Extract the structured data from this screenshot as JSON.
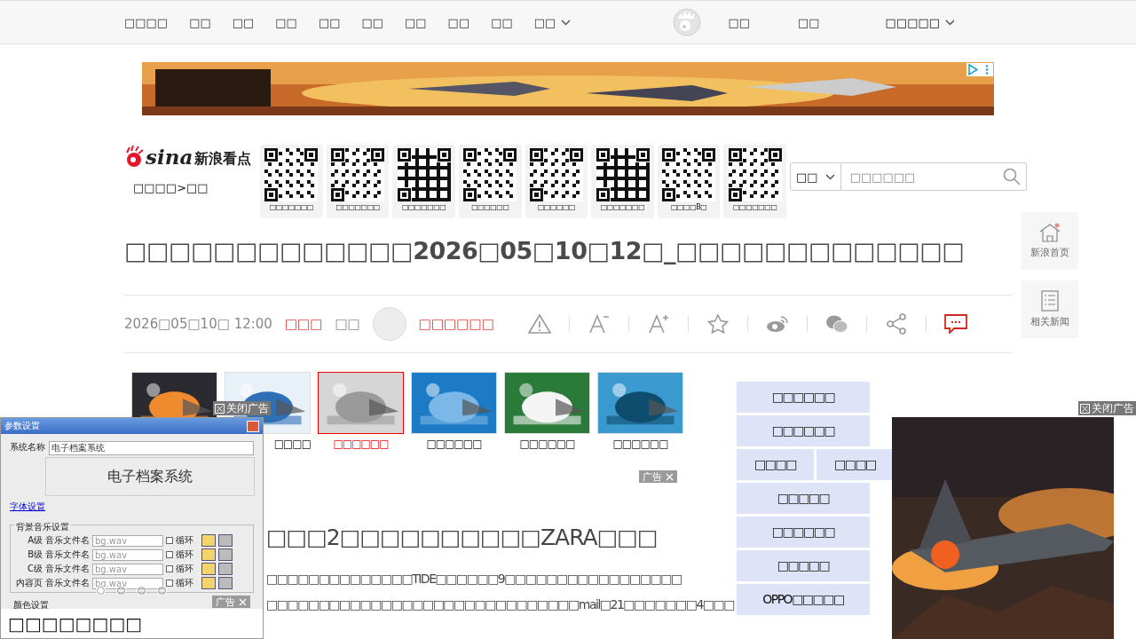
{
  "nav": {
    "items": [
      "□□□□",
      "□□",
      "□□",
      "□□",
      "□□",
      "□□",
      "□□",
      "□□",
      "□□"
    ],
    "more": "□□",
    "user_links": [
      "□□",
      "□□"
    ],
    "region": "□□□□□"
  },
  "header": {
    "logo_latin": "sina",
    "logo_cn": "新浪看点",
    "breadcrumb": "□□□□>□□",
    "qr_codes": [
      {
        "caption": "□□□□□□□"
      },
      {
        "caption": "□□□□□□□"
      },
      {
        "caption": "□□□□□□□"
      },
      {
        "caption": "□□□□□□"
      },
      {
        "caption": "□□□□□□"
      },
      {
        "caption": "□□□□□□□"
      },
      {
        "caption": "□□□□B□"
      },
      {
        "caption": "□□□□□□□"
      }
    ],
    "search": {
      "scope": "□□",
      "placeholder": "□□□□□□"
    }
  },
  "side_buttons": [
    {
      "kind": "home",
      "label": "新浪首页"
    },
    {
      "kind": "list",
      "label": "相关新闻"
    }
  ],
  "article": {
    "title": "□□□□□□□□□□□□□2026□05□10□12□_□□□□□□□□□□□□□",
    "date": "2026□05□10□ 12:00",
    "source": "□□□",
    "via": "□□",
    "author": "□□□□□□",
    "actions": [
      {
        "kind": "report"
      },
      {
        "kind": "smaller"
      },
      {
        "kind": "larger"
      },
      {
        "kind": "star"
      },
      {
        "kind": "weibo"
      },
      {
        "kind": "wechat"
      },
      {
        "kind": "share"
      },
      {
        "kind": "comment"
      }
    ],
    "subtitle": "□□□2□□□□□□□□□□ZARA□□□",
    "paragraph_lines": [
      "□□□□□□□□□□□□□□TIDE□□□□□□9□□□□□□□□□□□□□□□□□",
      "□□□□□□□□□□□□□□□□□□□□□□□□□□□□□□mail□21□□□□□□□4□□□"
    ]
  },
  "related": [
    {
      "selected": false
    },
    {
      "caption": "□□□□",
      "selected": false
    },
    {
      "caption": "□□□□□□",
      "selected": true
    },
    {
      "caption": "□□□□□□",
      "selected": false
    },
    {
      "caption": "□□□□□□",
      "selected": false
    },
    {
      "caption": "□□□□□□",
      "selected": false
    }
  ],
  "related_ad_tag": "广告",
  "tag_rows": [
    [
      "□□□□□□"
    ],
    [
      "□□□□□□"
    ],
    [
      "□□□□",
      "□□□□"
    ],
    [
      "□□□□□"
    ],
    [
      "□□□□□□"
    ],
    [
      "□□□□□"
    ],
    [
      "OPPO□□□□□"
    ]
  ],
  "popup_ad": {
    "close_label": "关闭广告",
    "window_title": "参数设置",
    "name_label": "系统名称",
    "name_value": "电子档案系统",
    "preview": "电子档案系统",
    "font_link": "字体设置",
    "music_group": "背景音乐设置",
    "music_rows": [
      {
        "level": "A级",
        "label": "音乐文件名",
        "file": "bg.wav",
        "loop": "循环",
        "checked": false
      },
      {
        "level": "B级",
        "label": "音乐文件名",
        "file": "bg.wav",
        "loop": "循环",
        "checked": false
      },
      {
        "level": "C级",
        "label": "音乐文件名",
        "file": "bg.wav",
        "loop": "循环",
        "checked": false
      },
      {
        "level": "内容页",
        "label": "音乐文件名",
        "file": "bg.wav",
        "loop": "循环",
        "checked": false
      }
    ],
    "color_group": "颜色设置",
    "dots": [
      {
        "selected": true
      },
      {
        "selected": false
      },
      {
        "selected": false
      },
      {
        "selected": false
      }
    ],
    "ad_tag": "广告",
    "caption": "□□□□□□□□"
  },
  "right_ad": {
    "close_label": "关闭广告"
  }
}
